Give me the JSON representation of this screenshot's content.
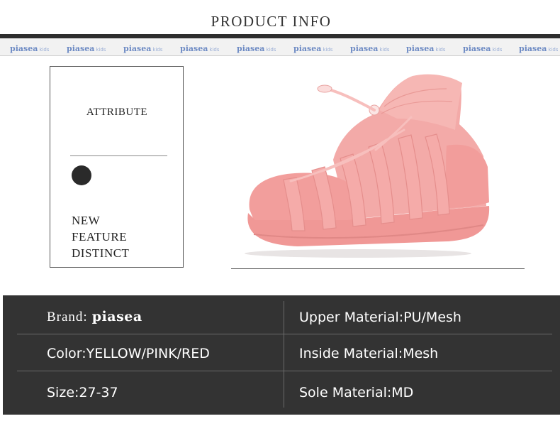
{
  "header": {
    "title": "PRODUCT INFO"
  },
  "logo_strip": {
    "word": "piasea",
    "suffix": "kids",
    "color": "#6e8bc4"
  },
  "attribute_card": {
    "title": "ATTRIBUTE",
    "features": [
      "NEW",
      "FEATURE",
      "DISTINCT"
    ]
  },
  "product_image": {
    "description_icon": "pink-knit-sandal-sneaker-image",
    "primary_color": "#f0a3a3"
  },
  "specs": {
    "brand_label": "Brand:",
    "brand_logo": "piasea",
    "upper_material": "Upper Material:PU/Mesh",
    "color": "Color:YELLOW/PINK/RED",
    "inside_material": "Inside Material:Mesh",
    "size": "Size:27-37",
    "sole_material": "Sole Material:MD"
  },
  "colors": {
    "band_bg": "#333333",
    "rule": "#2e2e2e",
    "strip_bg": "#f2f2f2"
  }
}
